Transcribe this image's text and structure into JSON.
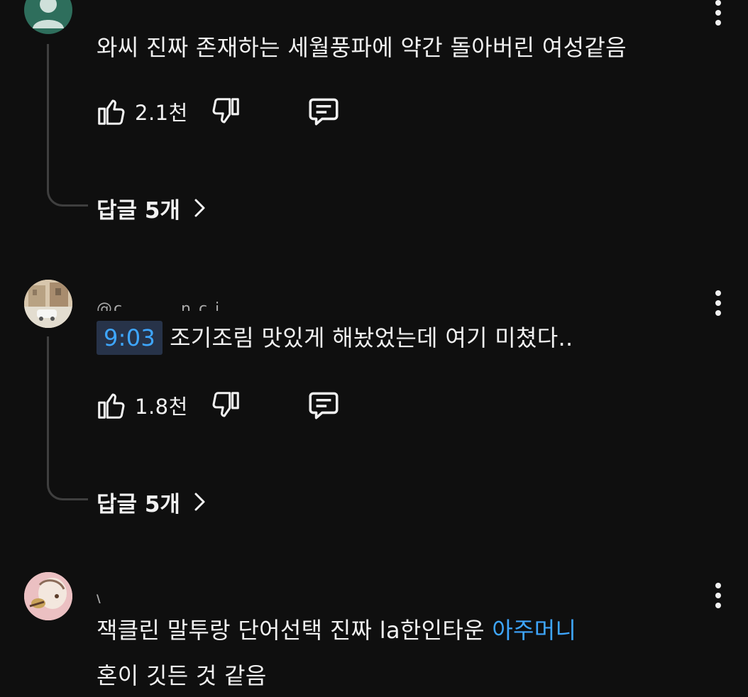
{
  "comments": [
    {
      "text": "와씨 진짜 존재하는 세월풍파에 약간 돌아버린 여성같음",
      "likes": "2.1천",
      "replies_label": "답글 5개"
    },
    {
      "handle": "@c        . . . . n c j                              ,",
      "timestamp": "9:03",
      "text": "조기조림 맛있게 해놨었는데 여기 미쳤다..",
      "likes": "1.8천",
      "replies_label": "답글 5개"
    },
    {
      "handle": "\\                                    ,        _  ,",
      "text_line1_plain": "잭클린 말투랑 단어선택 진짜 la한인타운 ",
      "text_line1_link": "아주머니",
      "text_line2": "혼이 깃든 것 같음"
    }
  ],
  "icons": {
    "like": "thumb-up-icon",
    "dislike": "thumb-down-icon",
    "reply": "comment-reply-icon",
    "more": "more-vert-icon",
    "chevron": "chevron-right-icon"
  },
  "colors": {
    "background": "#0f0f0f",
    "text": "#f1f1f1",
    "link": "#3ea6ff",
    "timestamp_bg": "#273349",
    "thread_line": "#3f3f3f"
  }
}
